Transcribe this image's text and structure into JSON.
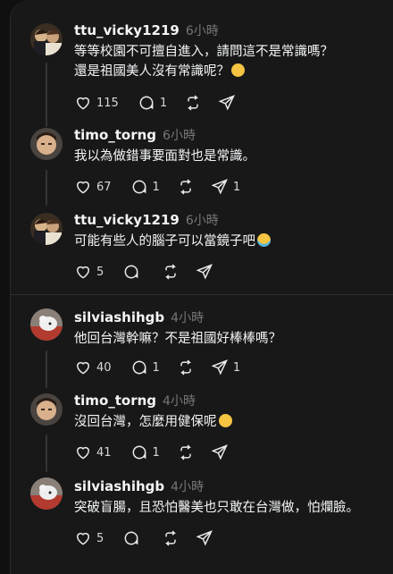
{
  "posts": [
    {
      "username": "ttu_vicky1219",
      "time": "6小時",
      "line1": "等等校園不可擅自進入，請問這不是常識嗎？",
      "line2": "還是祖國美人沒有常識呢？",
      "emoji": "disappointed-face",
      "likes": "115",
      "replies": "1",
      "reposts": "",
      "shares": ""
    },
    {
      "username": "timo_torng",
      "time": "6小時",
      "line1": "我以為做錯事要面對也是常識。",
      "likes": "67",
      "replies": "1",
      "reposts": "",
      "shares": "1"
    },
    {
      "username": "ttu_vicky1219",
      "time": "6小時",
      "line1": "可能有些人的腦子可以當鏡子吧",
      "emoji": "crying-face",
      "likes": "5",
      "replies": "",
      "reposts": "",
      "shares": ""
    },
    {
      "username": "silviashihgb",
      "time": "4小時",
      "line1": "他回台灣幹嘛？不是祖國好棒棒嗎？",
      "likes": "40",
      "replies": "1",
      "reposts": "",
      "shares": "1"
    },
    {
      "username": "timo_torng",
      "time": "4小時",
      "line1": "沒回台灣，怎麼用健保呢",
      "emoji": "grimacing-face",
      "likes": "41",
      "replies": "1",
      "reposts": "",
      "shares": ""
    },
    {
      "username": "silviashihgb",
      "time": "4小時",
      "line1": "突破盲腸，且恐怕醫美也只敢在台灣做，怕爛臉。",
      "likes": "5",
      "replies": "",
      "reposts": "",
      "shares": ""
    }
  ],
  "colors": {
    "background": "#181818",
    "text": "#f3f5f7",
    "muted": "#777777",
    "divider": "#2e2e2e"
  },
  "icons": [
    "heart-icon",
    "comment-icon",
    "repost-icon",
    "share-icon"
  ]
}
